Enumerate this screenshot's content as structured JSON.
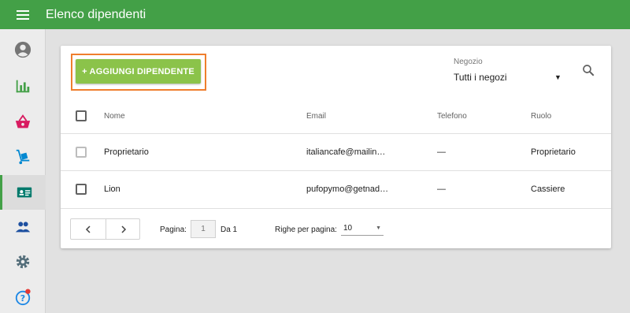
{
  "app": {
    "title": "Elenco dipendenti"
  },
  "icons": {
    "menu": "hamburger-menu-icon",
    "sidebar": [
      "account-circle-icon",
      "bar-chart-icon",
      "basket-icon",
      "hand-truck-icon",
      "id-card-icon",
      "people-icon",
      "gear-icon",
      "help-icon"
    ],
    "search": "search-icon"
  },
  "colors": {
    "topbar": "#43a047",
    "add_button": "#8bc34a",
    "highlight": "#ef7e2d",
    "notification": "#e53935"
  },
  "toolbar": {
    "add_label": "+ AGGIUNGI DIPENDENTE",
    "store_label": "Negozio",
    "store_value": "Tutti i negozi"
  },
  "table": {
    "headers": {
      "name": "Nome",
      "email": "Email",
      "phone": "Telefono",
      "role": "Ruolo"
    },
    "rows": [
      {
        "name": "Proprietario",
        "email": "italiancafe@mailin…",
        "phone": "—",
        "role": "Proprietario"
      },
      {
        "name": "Lion",
        "email": "pufopymo@getnad…",
        "phone": "—",
        "role": "Cassiere"
      }
    ]
  },
  "pagination": {
    "page_label": "Pagina:",
    "page_value": "1",
    "of_label": "Da 1",
    "rows_label": "Righe per pagina:",
    "rows_value": "10"
  }
}
